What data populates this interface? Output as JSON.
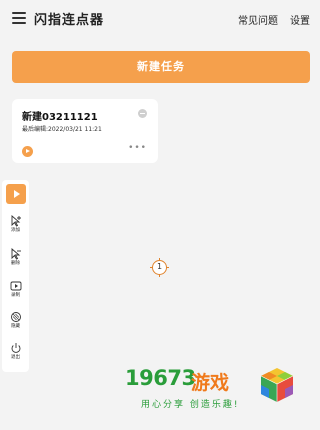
{
  "header": {
    "title": "闪指连点器",
    "faq_label": "常见问题",
    "settings_label": "设置"
  },
  "main": {
    "new_task_label": "新建任务",
    "task": {
      "name": "新建03211121",
      "last_edit": "最后编辑:2022/03/21 11:21"
    }
  },
  "toolbar": {
    "items": [
      {
        "icon": "add-click-point-icon",
        "label": "添加"
      },
      {
        "icon": "remove-click-point-icon",
        "label": "删除"
      },
      {
        "icon": "record-icon",
        "label": "录制"
      },
      {
        "icon": "hide-icon",
        "label": "隐藏"
      },
      {
        "icon": "power-icon",
        "label": "退出"
      }
    ]
  },
  "click_target": {
    "number": "1"
  },
  "watermark": {
    "brand_number": "19673",
    "brand_text": "游戏",
    "slogan": "用心分享 创造乐趣!"
  },
  "colors": {
    "accent": "#f5a04c",
    "background": "#f3f3f3",
    "watermark_green": "#2a9d3a",
    "watermark_orange": "#f07a1c"
  }
}
